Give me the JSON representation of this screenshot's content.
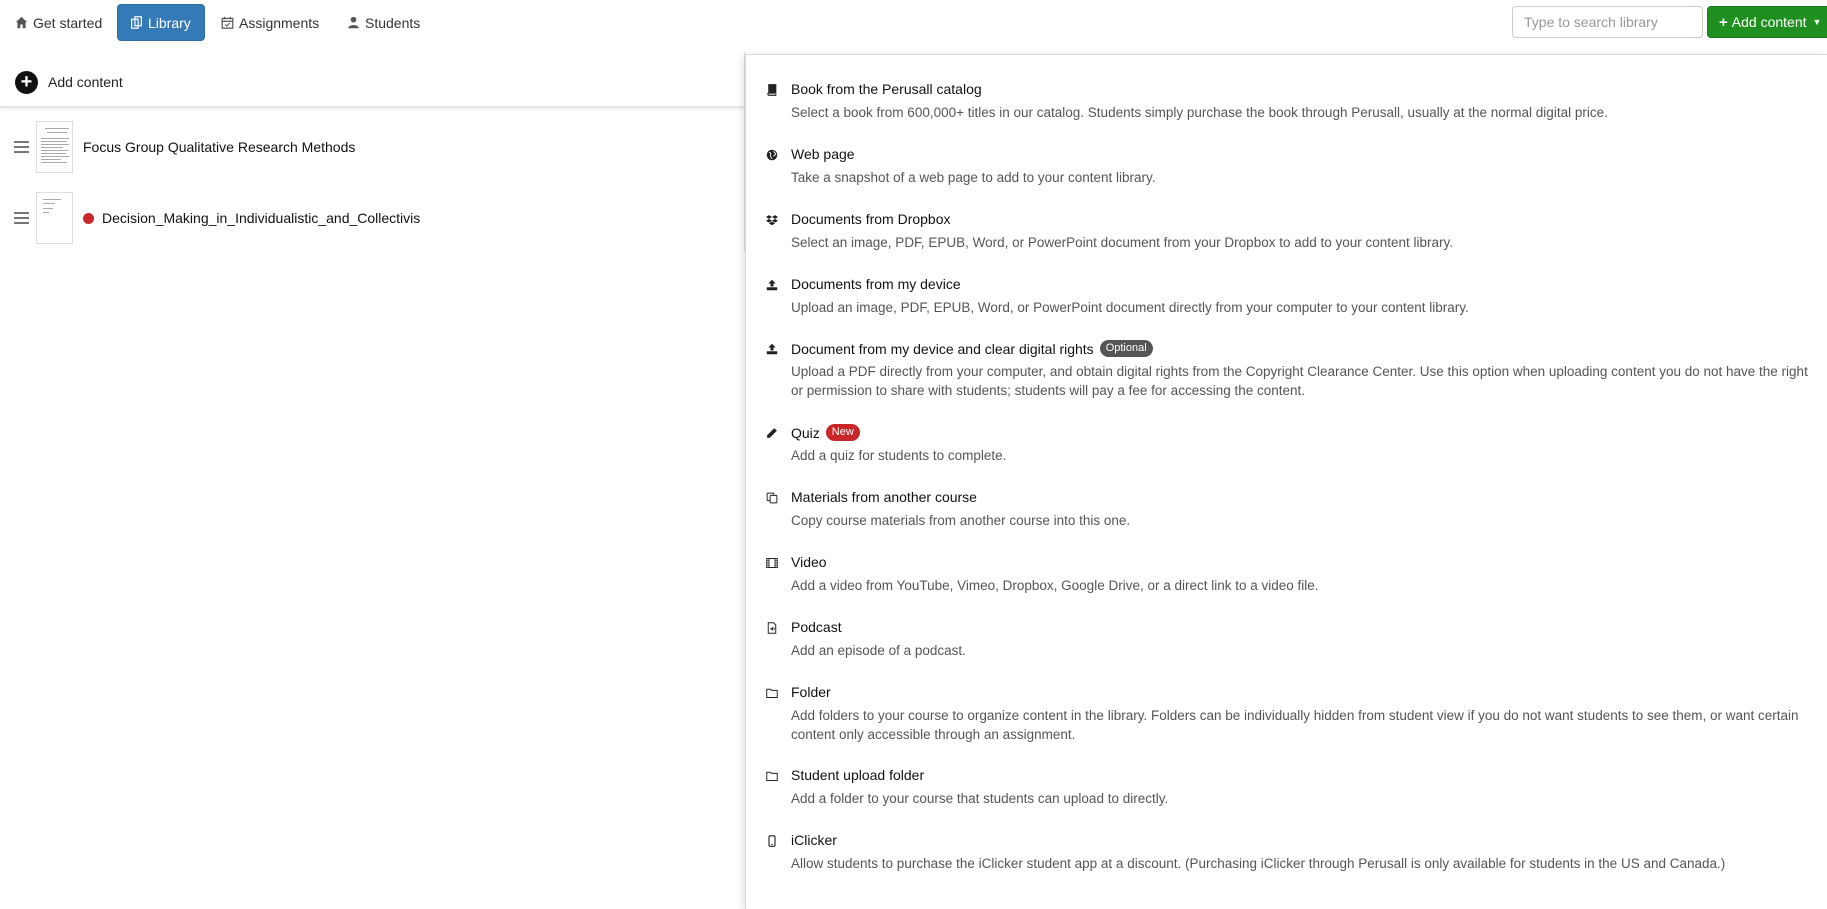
{
  "nav": {
    "tabs": [
      {
        "label": "Get started",
        "icon": "home-icon"
      },
      {
        "label": "Library",
        "icon": "library-icon",
        "active": true
      },
      {
        "label": "Assignments",
        "icon": "calendar-icon"
      },
      {
        "label": "Students",
        "icon": "user-icon"
      }
    ],
    "search_placeholder": "Type to search library",
    "add_content_label": "Add content"
  },
  "library": {
    "add_content_label": "Add content",
    "documents": [
      {
        "title": "Focus Group Qualitative Research Methods",
        "unread": false
      },
      {
        "title": "Decision_Making_in_Individualistic_and_Collectivis",
        "unread": true
      }
    ]
  },
  "menu": {
    "items": [
      {
        "title": "Book from the Perusall catalog",
        "icon": "book-icon",
        "description": "Select a book from 600,000+ titles in our catalog. Students simply purchase the book through Perusall, usually at the normal digital price."
      },
      {
        "title": "Web page",
        "icon": "globe-icon",
        "description": "Take a snapshot of a web page to add to your content library."
      },
      {
        "title": "Documents from Dropbox",
        "icon": "dropbox-icon",
        "description": "Select an image, PDF, EPUB, Word, or PowerPoint document from your Dropbox to add to your content library."
      },
      {
        "title": "Documents from my device",
        "icon": "upload-icon",
        "description": "Upload an image, PDF, EPUB, Word, or PowerPoint document directly from your computer to your content library."
      },
      {
        "title": "Document from my device and clear digital rights",
        "icon": "upload-icon",
        "badge": "Optional",
        "description": "Upload a PDF directly from your computer, and obtain digital rights from the Copyright Clearance Center. Use this option when uploading content you do not have the right or permission to share with students; students will pay a fee for accessing the content."
      },
      {
        "title": "Quiz",
        "icon": "pencil-icon",
        "badge": "New",
        "description": "Add a quiz for students to complete."
      },
      {
        "title": "Materials from another course",
        "icon": "copy-icon",
        "description": "Copy course materials from another course into this one."
      },
      {
        "title": "Video",
        "icon": "film-icon",
        "description": "Add a video from YouTube, Vimeo, Dropbox, Google Drive, or a direct link to a video file."
      },
      {
        "title": "Podcast",
        "icon": "audio-file-icon",
        "description": "Add an episode of a podcast."
      },
      {
        "title": "Folder",
        "icon": "folder-icon",
        "description": "Add folders to your course to organize content in the library. Folders can be individually hidden from student view if you do not want students to see them, or want certain content only accessible through an assignment."
      },
      {
        "title": "Student upload folder",
        "icon": "folder-icon",
        "description": "Add a folder to your course that students can upload to directly."
      },
      {
        "title": "iClicker",
        "icon": "mobile-icon",
        "description": "Allow students to purchase the iClicker student app at a discount. (Purchasing iClicker through Perusall is only available for students in the US and Canada.)"
      }
    ]
  },
  "colors": {
    "primary": "#337ab7",
    "success": "#1f8f1f",
    "danger": "#c9262a",
    "badge_dark": "#555555"
  }
}
